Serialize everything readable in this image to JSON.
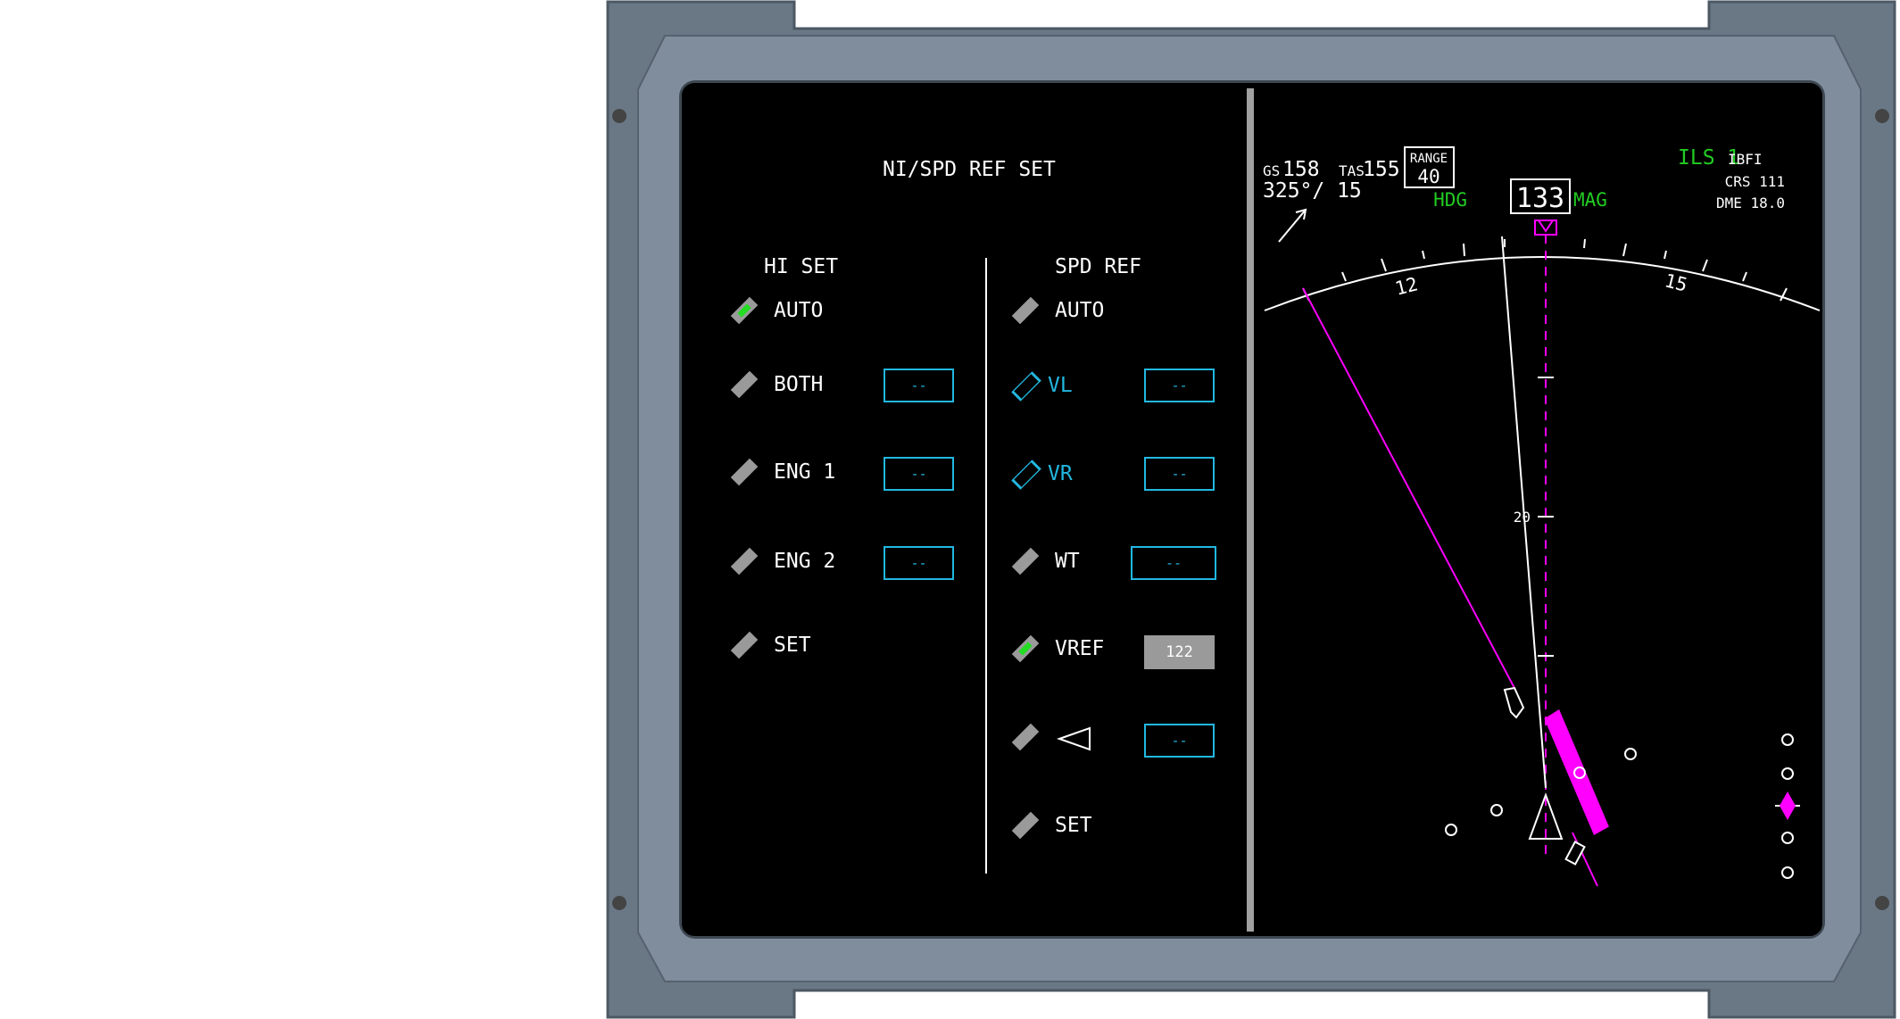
{
  "left_page": {
    "title": "NI/SPD REF SET",
    "hi_set": {
      "header": "HI SET",
      "items": [
        {
          "label": "AUTO",
          "selected": true
        },
        {
          "label": "BOTH",
          "value": "--"
        },
        {
          "label": "ENG 1",
          "value": "--"
        },
        {
          "label": "ENG 2",
          "value": "--"
        },
        {
          "label": "SET"
        }
      ]
    },
    "spd_ref": {
      "header": "SPD REF",
      "items": [
        {
          "label": "AUTO"
        },
        {
          "label": "VL",
          "value": "--"
        },
        {
          "label": "VR",
          "value": "--"
        },
        {
          "label": "WT",
          "value": "--"
        },
        {
          "label": "VREF",
          "value": "122",
          "selected": true
        },
        {
          "label": "",
          "icon": "triangle-left-icon",
          "value": "--"
        },
        {
          "label": "SET"
        }
      ]
    }
  },
  "nd": {
    "gs_label": "GS",
    "gs": "158",
    "tas_label": "TAS",
    "tas": "155",
    "wind": "325°/ 15",
    "range_label": "RANGE",
    "range": "40",
    "hdg_label": "HDG",
    "heading": "133",
    "mag_label": "MAG",
    "ils_label": "ILS 1",
    "ident": "IBFI",
    "crs": "CRS 111",
    "dme": "DME 18.0",
    "compass_labels": [
      "12",
      "15"
    ],
    "range_mark": "20"
  },
  "colors": {
    "bezel": "#6c7a88",
    "screen": "#000000",
    "cyan": "#22b8e0",
    "green": "#22cc22",
    "magenta": "#ff00ff",
    "gray": "#9a9a9a"
  }
}
